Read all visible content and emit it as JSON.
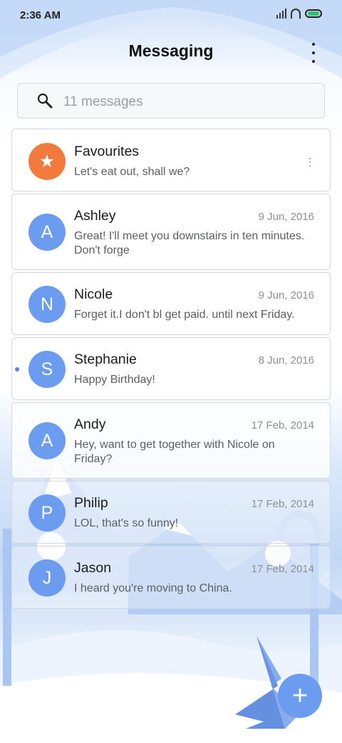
{
  "status": {
    "time": "2:36 AM"
  },
  "app": {
    "title": "Messaging"
  },
  "search": {
    "placeholder": "11 messages"
  },
  "conversations": [
    {
      "avatar_letter": "★",
      "name": "Favourites",
      "date": "",
      "snippet": "Let's eat out, shall we?",
      "avatar_color": "#f37a3d"
    },
    {
      "avatar_letter": "A",
      "name": "Ashley",
      "date": "9 Jun, 2016",
      "snippet": "Great! I'll meet you downstairs in ten minutes. Don't forge"
    },
    {
      "avatar_letter": "N",
      "name": "Nicole",
      "date": "9 Jun, 2016",
      "snippet": "Forget it.I don't bl get paid. until next Friday."
    },
    {
      "avatar_letter": "S",
      "name": "Stephanie",
      "date": "8 Jun, 2016",
      "snippet": "Happy Birthday!",
      "unread": true
    },
    {
      "avatar_letter": "A",
      "name": "Andy",
      "date": "17 Feb, 2014",
      "snippet": "Hey, want to get together with Nicole on Friday?"
    },
    {
      "avatar_letter": "P",
      "name": "Philip",
      "date": "17 Feb, 2014",
      "snippet": "LOL, that's so funny!"
    },
    {
      "avatar_letter": "J",
      "name": "Jason",
      "date": "17 Feb, 2014",
      "snippet": "I heard you're moving to China."
    }
  ],
  "fab": {
    "label": "+"
  },
  "colors": {
    "accent": "#6b9cf0",
    "favourite": "#f37a3d",
    "unread_dot": "#4e89ee"
  }
}
